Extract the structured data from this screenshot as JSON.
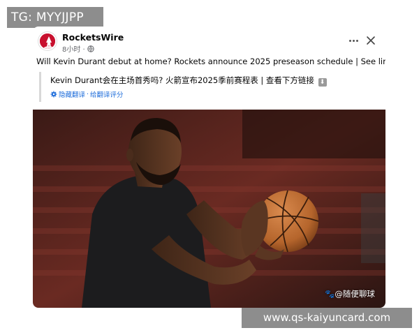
{
  "watermark": {
    "tg_label": "TG: MYYJJPP"
  },
  "post": {
    "page_name": "RocketsWire",
    "time_ago": "8小时 ·",
    "audience_icon": "globe-icon",
    "menu_icon": "more-horizontal-icon",
    "close_icon": "close-icon",
    "text": "Will Kevin Durant debut at home? Rockets announce 2025 preseason schedule | See link below",
    "text_emoji": "down-arrow-emoji",
    "translation": {
      "text": "Kevin Durant会在主场首秀吗? 火箭宣布2025季前赛程表 | 查看下方链接",
      "settings_icon": "gear-icon",
      "hide_link": "隐藏翻译",
      "separator": " · ",
      "rate_link": "给翻译评分"
    }
  },
  "photo": {
    "subject": "basketball player holding a basketball",
    "credit": "🐾@随便聊球"
  },
  "url_banner": {
    "text": "www.qs-kaiyuncard.com"
  },
  "colors": {
    "link": "#216fdb",
    "avatar_red": "#c8102e",
    "banner_gray": "#8d8d8d"
  }
}
